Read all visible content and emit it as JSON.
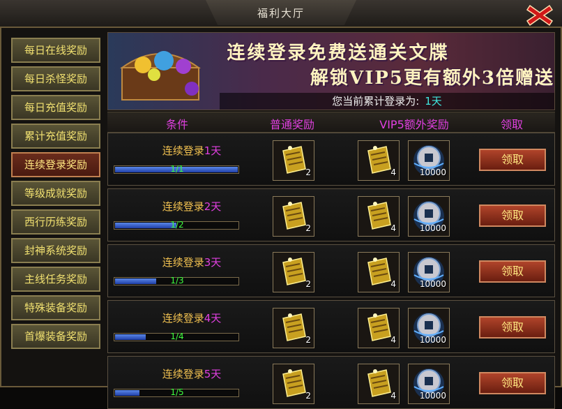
{
  "window": {
    "title": "福利大厅"
  },
  "sidebar": {
    "items": [
      {
        "label": "每日在线奖励",
        "active": false
      },
      {
        "label": "每日杀怪奖励",
        "active": false
      },
      {
        "label": "每日充值奖励",
        "active": false
      },
      {
        "label": "累计充值奖励",
        "active": false
      },
      {
        "label": "连续登录奖励",
        "active": true
      },
      {
        "label": "等级成就奖励",
        "active": false
      },
      {
        "label": "西行历练奖励",
        "active": false
      },
      {
        "label": "封神系统奖励",
        "active": false
      },
      {
        "label": "主线任务奖励",
        "active": false
      },
      {
        "label": "特殊装备奖励",
        "active": false
      },
      {
        "label": "首爆装备奖励",
        "active": false
      }
    ]
  },
  "banner": {
    "line1": "连续登录免费送通关文牒",
    "line2": "解锁VIP5更有额外3倍赠送",
    "status_label": "您当前累计登录为:",
    "status_value": "1天"
  },
  "table": {
    "headers": [
      "条件",
      "普通奖励",
      "VIP5额外奖励",
      "领取"
    ],
    "rows": [
      {
        "cond_prefix": "连续登录",
        "days": "1天",
        "progress_text": "1/1",
        "progress": 1.0,
        "normal_count": "2",
        "vip_count": "4",
        "vip_gold": "10000",
        "claim": "领取"
      },
      {
        "cond_prefix": "连续登录",
        "days": "2天",
        "progress_text": "1/2",
        "progress": 0.5,
        "normal_count": "2",
        "vip_count": "4",
        "vip_gold": "10000",
        "claim": "领取"
      },
      {
        "cond_prefix": "连续登录",
        "days": "3天",
        "progress_text": "1/3",
        "progress": 0.333,
        "normal_count": "2",
        "vip_count": "4",
        "vip_gold": "10000",
        "claim": "领取"
      },
      {
        "cond_prefix": "连续登录",
        "days": "4天",
        "progress_text": "1/4",
        "progress": 0.25,
        "normal_count": "2",
        "vip_count": "4",
        "vip_gold": "10000",
        "claim": "领取"
      },
      {
        "cond_prefix": "连续登录",
        "days": "5天",
        "progress_text": "1/5",
        "progress": 0.2,
        "normal_count": "2",
        "vip_count": "4",
        "vip_gold": "10000",
        "claim": "领取"
      }
    ]
  },
  "colors": {
    "accent_magenta": "#e040e0",
    "condition_gold": "#f0c050",
    "progress_green": "#40ff40",
    "status_cyan": "#40e8e0"
  },
  "icons": {
    "reward_item": "pass-document-icon",
    "gold_item": "gold-coin-icon",
    "close": "close-icon"
  }
}
